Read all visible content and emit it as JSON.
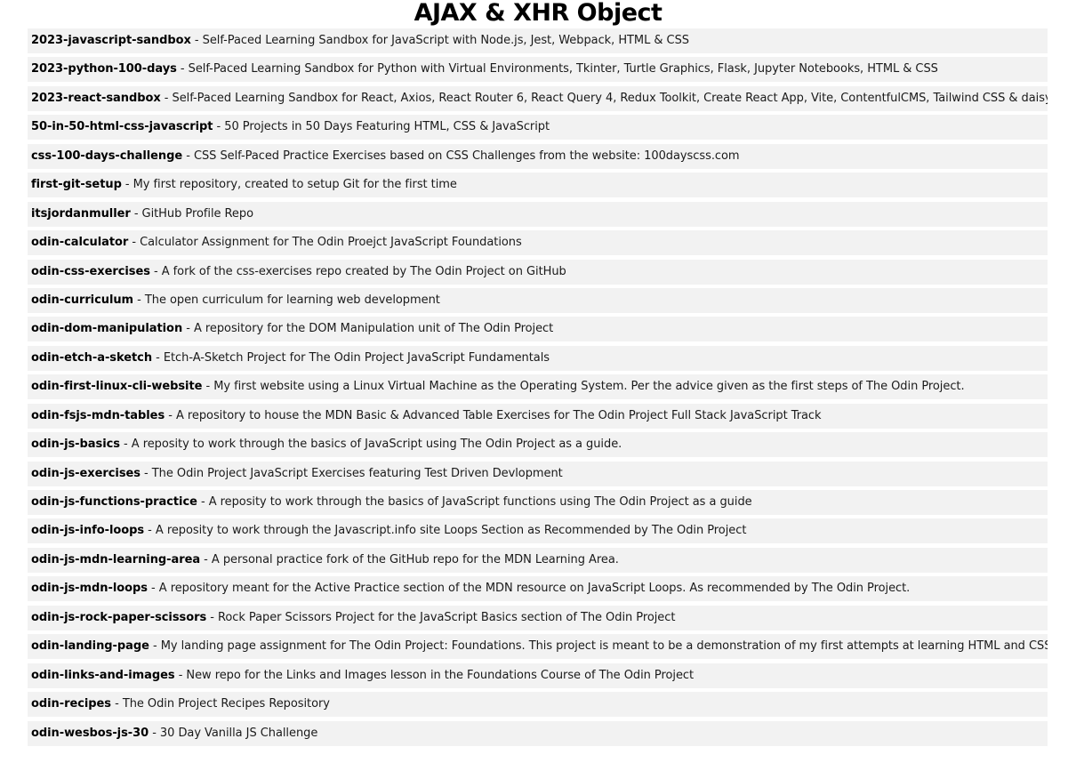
{
  "page": {
    "title": "AJAX & XHR Object"
  },
  "repos": [
    {
      "name": "2023-javascript-sandbox",
      "description": "Self-Paced Learning Sandbox for JavaScript with Node.js, Jest, Webpack, HTML & CSS"
    },
    {
      "name": "2023-python-100-days",
      "description": "Self-Paced Learning Sandbox for Python with Virtual Environments, Tkinter, Turtle Graphics, Flask, Jupyter Notebooks, HTML & CSS"
    },
    {
      "name": "2023-react-sandbox",
      "description": "Self-Paced Learning Sandbox for React, Axios, React Router 6, React Query 4, Redux Toolkit, Create React App, Vite, ContentfulCMS, Tailwind CSS & daisyUI"
    },
    {
      "name": "50-in-50-html-css-javascript",
      "description": "50 Projects in 50 Days Featuring HTML, CSS & JavaScript"
    },
    {
      "name": "css-100-days-challenge",
      "description": "CSS Self-Paced Practice Exercises based on CSS Challenges from the website: 100dayscss.com"
    },
    {
      "name": "first-git-setup",
      "description": "My first repository, created to setup Git for the first time"
    },
    {
      "name": "itsjordanmuller",
      "description": "GitHub Profile Repo"
    },
    {
      "name": "odin-calculator",
      "description": "Calculator Assignment for The Odin Proejct JavaScript Foundations"
    },
    {
      "name": "odin-css-exercises",
      "description": "A fork of the css-exercises repo created by The Odin Project on GitHub"
    },
    {
      "name": "odin-curriculum",
      "description": "The open curriculum for learning web development"
    },
    {
      "name": "odin-dom-manipulation",
      "description": "A repository for the DOM Manipulation unit of The Odin Project"
    },
    {
      "name": "odin-etch-a-sketch",
      "description": "Etch-A-Sketch Project for The Odin Project JavaScript Fundamentals"
    },
    {
      "name": "odin-first-linux-cli-website",
      "description": "My first website using a Linux Virtual Machine as the Operating System. Per the advice given as the first steps of The Odin Project."
    },
    {
      "name": "odin-fsjs-mdn-tables",
      "description": "A repository to house the MDN Basic & Advanced Table Exercises for The Odin Project Full Stack JavaScript Track"
    },
    {
      "name": "odin-js-basics",
      "description": "A reposity to work through the basics of JavaScript using The Odin Project as a guide."
    },
    {
      "name": "odin-js-exercises",
      "description": "The Odin Project JavaScript Exercises featuring Test Driven Devlopment"
    },
    {
      "name": "odin-js-functions-practice",
      "description": "A reposity to work through the basics of JavaScript functions using The Odin Project as a guide"
    },
    {
      "name": "odin-js-info-loops",
      "description": "A reposity to work through the Javascript.info site Loops Section as Recommended by The Odin Project"
    },
    {
      "name": "odin-js-mdn-learning-area",
      "description": "A personal practice fork of the GitHub repo for the MDN Learning Area."
    },
    {
      "name": "odin-js-mdn-loops",
      "description": "A repository meant for the Active Practice section of the MDN resource on JavaScript Loops. As recommended by The Odin Project."
    },
    {
      "name": "odin-js-rock-paper-scissors",
      "description": "Rock Paper Scissors Project for the JavaScript Basics section of The Odin Project"
    },
    {
      "name": "odin-landing-page",
      "description": "My landing page assignment for The Odin Project: Foundations. This project is meant to be a demonstration of my first attempts at learning HTML and CSS."
    },
    {
      "name": "odin-links-and-images",
      "description": "New repo for the Links and Images lesson in the Foundations Course of The Odin Project"
    },
    {
      "name": "odin-recipes",
      "description": "The Odin Project Recipes Repository"
    },
    {
      "name": "odin-wesbos-js-30",
      "description": "30 Day Vanilla JS Challenge"
    }
  ],
  "separator": " - "
}
